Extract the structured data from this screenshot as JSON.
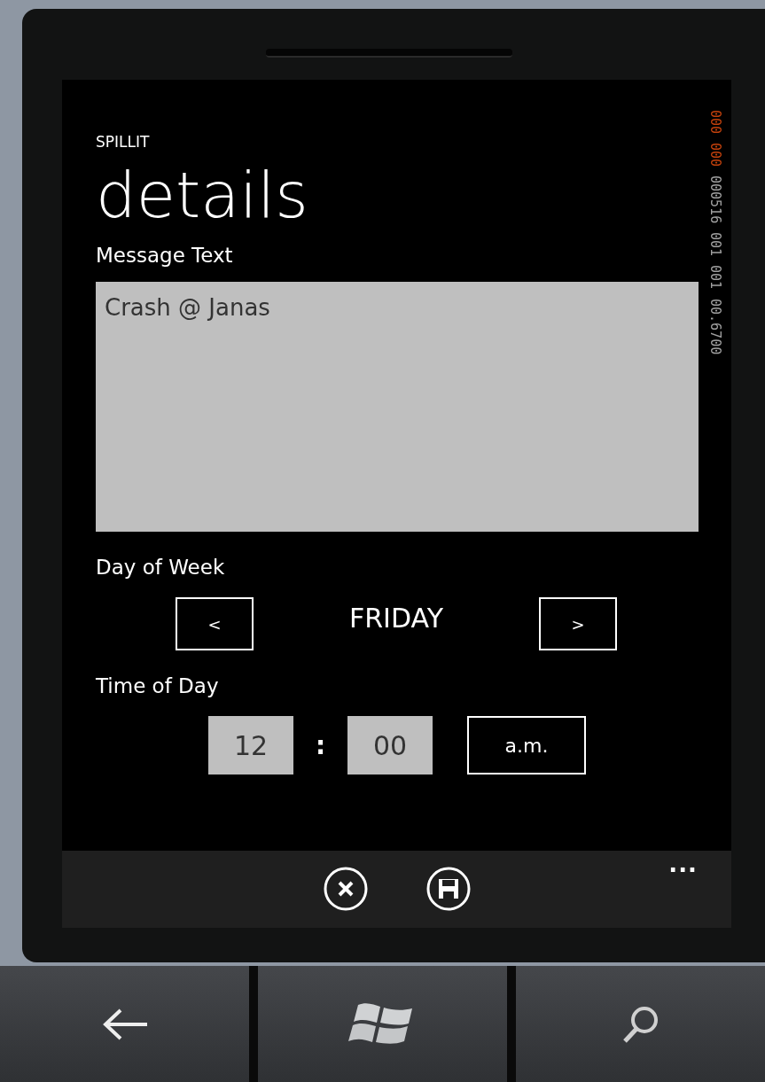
{
  "app_title": "SPILLIT",
  "page_title": "details",
  "message": {
    "label": "Message Text",
    "value": "Crash @ Janas"
  },
  "day": {
    "label": "Day of Week",
    "prev": "<",
    "value": "FRIDAY",
    "next": ">"
  },
  "time": {
    "label": "Time of Day",
    "hour": "12",
    "separator": ":",
    "minute": "00",
    "period": "a.m."
  },
  "app_bar": {
    "buttons": [
      {
        "kind": "cancel"
      },
      {
        "kind": "save"
      }
    ],
    "more": "..."
  },
  "frame_counters": [
    {
      "value": "000",
      "color": "#c2410c"
    },
    {
      "value": "000",
      "color": "#c2410c"
    },
    {
      "value": "000516",
      "color": "#a0a0a0"
    },
    {
      "value": "001",
      "color": "#a0a0a0"
    },
    {
      "value": "001",
      "color": "#a0a0a0"
    },
    {
      "value": "00.6700",
      "color": "#a0a0a0"
    }
  ],
  "hardware_keys": [
    {
      "kind": "back"
    },
    {
      "kind": "start"
    },
    {
      "kind": "search"
    }
  ]
}
